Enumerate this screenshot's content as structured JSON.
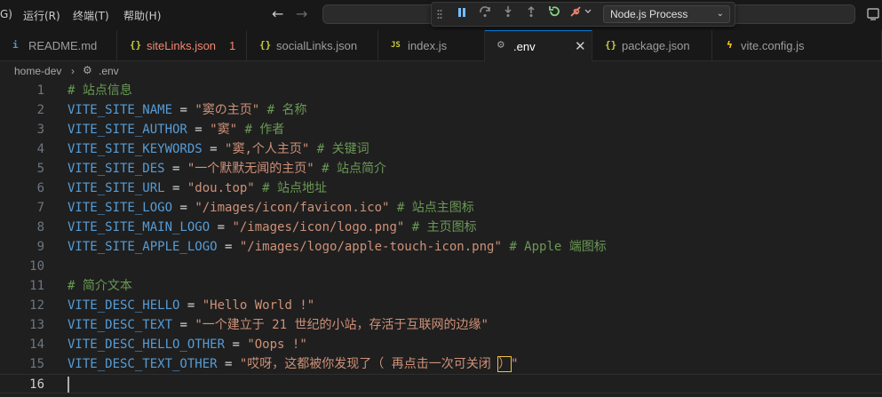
{
  "menu": {
    "cut_label": "G)",
    "run_label": "运行(R)",
    "terminal_label": "终端(T)",
    "help_label": "帮助(H)"
  },
  "debug": {
    "process_label": "Node.js Process"
  },
  "tabs": [
    {
      "icon": "markdown-icon",
      "label": "README.md"
    },
    {
      "icon": "json-icon",
      "label": "siteLinks.json",
      "badge": "1",
      "modified": true
    },
    {
      "icon": "json-icon",
      "label": "socialLinks.json"
    },
    {
      "icon": "js-icon",
      "label": "index.js"
    },
    {
      "icon": "gear-icon",
      "label": ".env",
      "active": true
    },
    {
      "icon": "json-icon",
      "label": "package.json"
    },
    {
      "icon": "vite-icon",
      "label": "vite.config.js"
    }
  ],
  "tab_icon_glyphs": {
    "json": "{}",
    "js": "JS",
    "info": "i",
    "gear": "⚙",
    "vite": "ϟ",
    "sep": "›"
  },
  "breadcrumb": {
    "folder": "home-dev",
    "file": ".env"
  },
  "colors": {
    "comment": "#6a9955",
    "key": "#569cd6",
    "string": "#ce9178",
    "accent": "#0078d4"
  },
  "editor": {
    "current_line": 16,
    "lines": [
      {
        "n": "1",
        "comment": "# 站点信息"
      },
      {
        "n": "2",
        "key": "VITE_SITE_NAME",
        "op": " = ",
        "value": "\"窦の主页\"",
        "comment": " # 名称"
      },
      {
        "n": "3",
        "key": "VITE_SITE_AUTHOR",
        "op": " = ",
        "value": "\"窦\"",
        "comment": " # 作者"
      },
      {
        "n": "4",
        "key": "VITE_SITE_KEYWORDS",
        "op": " = ",
        "value": "\"窦,个人主页\"",
        "comment": " # 关键词"
      },
      {
        "n": "5",
        "key": "VITE_SITE_DES",
        "op": " = ",
        "value": "\"一个默默无闻的主页\"",
        "comment": " # 站点简介"
      },
      {
        "n": "6",
        "key": "VITE_SITE_URL",
        "op": " = ",
        "value": "\"dou.top\"",
        "comment": " # 站点地址"
      },
      {
        "n": "7",
        "key": "VITE_SITE_LOGO",
        "op": " = ",
        "value": "\"/images/icon/favicon.ico\"",
        "comment": " # 站点主图标"
      },
      {
        "n": "8",
        "key": "VITE_SITE_MAIN_LOGO",
        "op": " = ",
        "value": "\"/images/icon/logo.png\"",
        "comment": " # 主页图标"
      },
      {
        "n": "9",
        "key": "VITE_SITE_APPLE_LOGO",
        "op": " = ",
        "value": "\"/images/logo/apple-touch-icon.png\"",
        "comment": " # Apple 端图标"
      },
      {
        "n": "10"
      },
      {
        "n": "11",
        "comment": "# 简介文本"
      },
      {
        "n": "12",
        "key": "VITE_DESC_HELLO",
        "op": " = ",
        "value": "\"Hello World !\""
      },
      {
        "n": "13",
        "key": "VITE_DESC_TEXT",
        "op": " = ",
        "value": "\"一个建立于 21 世纪的小站，存活于互联网的边缘\""
      },
      {
        "n": "14",
        "key": "VITE_DESC_HELLO_OTHER",
        "op": " = ",
        "value": "\"Oops !\""
      },
      {
        "n": "15",
        "key": "VITE_DESC_TEXT_OTHER",
        "op": " = ",
        "value_a": "\"哎呀，这都被你发现了（ 再点击一次可关闭 ",
        "value_b": "）",
        "value_c": "\""
      },
      {
        "n": "16"
      }
    ]
  }
}
